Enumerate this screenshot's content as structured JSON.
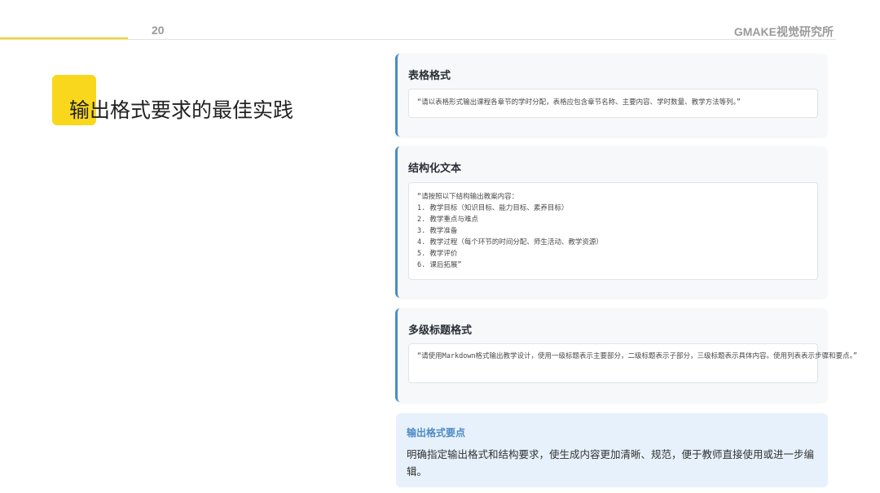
{
  "header": {
    "page_number": "20",
    "brand": "GMAKE视觉研究所"
  },
  "title": "输出格式要求的最佳实践",
  "cards": [
    {
      "title": "表格格式",
      "lines": [
        "“请以表格形式输出课程各章节的学时分配，表格应包含章节名称、主要内容、学时数量、教学方法等列。”"
      ]
    },
    {
      "title": "结构化文本",
      "lines": [
        "“请按照以下结构输出教案内容：",
        "1. 教学目标（知识目标、能力目标、素养目标）",
        "2. 教学重点与难点",
        "3. 教学准备",
        "4. 教学过程（每个环节的时间分配、师生活动、教学资源）",
        "5. 教学评价",
        "6. 课后拓展”"
      ]
    },
    {
      "title": "多级标题格式",
      "lines": [
        "“请使用Markdown格式输出教学设计，使用一级标题表示主要部分，二级标题表示子部分，三级标题表示具体内容。使用列表表示步骤和要点。”"
      ]
    }
  ],
  "keypoint": {
    "title": "输出格式要点",
    "text": "明确指定输出格式和结构要求，使生成内容更加清晰、规范，便于教师直接使用或进一步编辑。"
  },
  "colors": {
    "accent_yellow": "#f9d71c",
    "card_border_blue": "#4e8bc4",
    "keypoint_bg": "#e6f1fb"
  }
}
